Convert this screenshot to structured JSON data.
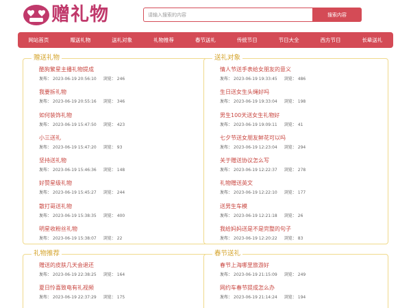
{
  "site": {
    "logo_text": "赠礼物"
  },
  "search": {
    "placeholder": "请输入搜索的内容",
    "button_label": "搜索内容"
  },
  "nav": [
    "网站首页",
    "赠送礼物",
    "送礼对象",
    "礼物推荐",
    "春节送礼",
    "传统节日",
    "节日大全",
    "西方节日",
    "长辈送礼"
  ],
  "meta_labels": {
    "published": "发布：",
    "views": "浏览："
  },
  "panels": {
    "gift": {
      "title": "赠送礼物",
      "items": [
        {
          "title": "酷狗繁星主播礼物提成",
          "date": "2023-06-19 20:56:10",
          "views": "246"
        },
        {
          "title": "我要拆礼物",
          "date": "2023-06-19 20:55:16",
          "views": "346"
        },
        {
          "title": "如何装饰礼物",
          "date": "2023-06-19 15:47:50",
          "views": "423"
        },
        {
          "title": "小三送礼",
          "date": "2023-06-19 15:47:20",
          "views": "93"
        },
        {
          "title": "坚持送礼物",
          "date": "2023-06-19 15:46:36",
          "views": "148"
        },
        {
          "title": "好赞星级礼物",
          "date": "2023-06-19 15:45:27",
          "views": "244"
        },
        {
          "title": "散打哥送礼物",
          "date": "2023-06-19 15:38:35",
          "views": "400"
        },
        {
          "title": "明星收粉丝礼物",
          "date": "2023-06-19 15:38:07",
          "views": "22"
        }
      ]
    },
    "target": {
      "title": "送礼对象",
      "items": [
        {
          "title": "情人节送手表给女朋友的意义",
          "date": "2023-06-19 19:33:45",
          "views": "486"
        },
        {
          "title": "生日送女生头绳好吗",
          "date": "2023-06-19 19:33:04",
          "views": "198"
        },
        {
          "title": "男生100天送女生礼物好",
          "date": "2023-06-19 19:09:11",
          "views": "41"
        },
        {
          "title": "七夕节送女朋友鲜花可以吗",
          "date": "2023-06-19 12:23:04",
          "views": "294"
        },
        {
          "title": "关于赠送协议怎么写",
          "date": "2023-06-19 12:22:37",
          "views": "278"
        },
        {
          "title": "礼物赠送英文",
          "date": "2023-06-19 12:22:10",
          "views": "177"
        },
        {
          "title": "送男生车模",
          "date": "2023-06-19 12:21:18",
          "views": "26"
        },
        {
          "title": "我给妈妈送是不是完整的句子",
          "date": "2023-06-19 12:20:22",
          "views": "83"
        }
      ]
    },
    "recommend": {
      "title": "礼物推荐",
      "items": [
        {
          "title": "赠送的皮肤几天会退还",
          "date": "2023-06-19 22:38:25",
          "views": "164"
        },
        {
          "title": "夏日怜喜致电有礼视频",
          "date": "2023-06-19 22:37:29",
          "views": "175"
        }
      ]
    },
    "spring": {
      "title": "春节送礼",
      "items": [
        {
          "title": "春节上海哪里旅游好",
          "date": "2023-06-19 21:15:09",
          "views": "249"
        },
        {
          "title": "网约车春节提成怎么办",
          "date": "2023-06-19 21:14:24",
          "views": "194"
        }
      ]
    }
  },
  "colors": {
    "brand_red": "#d44b56",
    "link_red": "#c8453f",
    "panel_border": "#f0d98a",
    "panel_title": "#d4a32a"
  }
}
